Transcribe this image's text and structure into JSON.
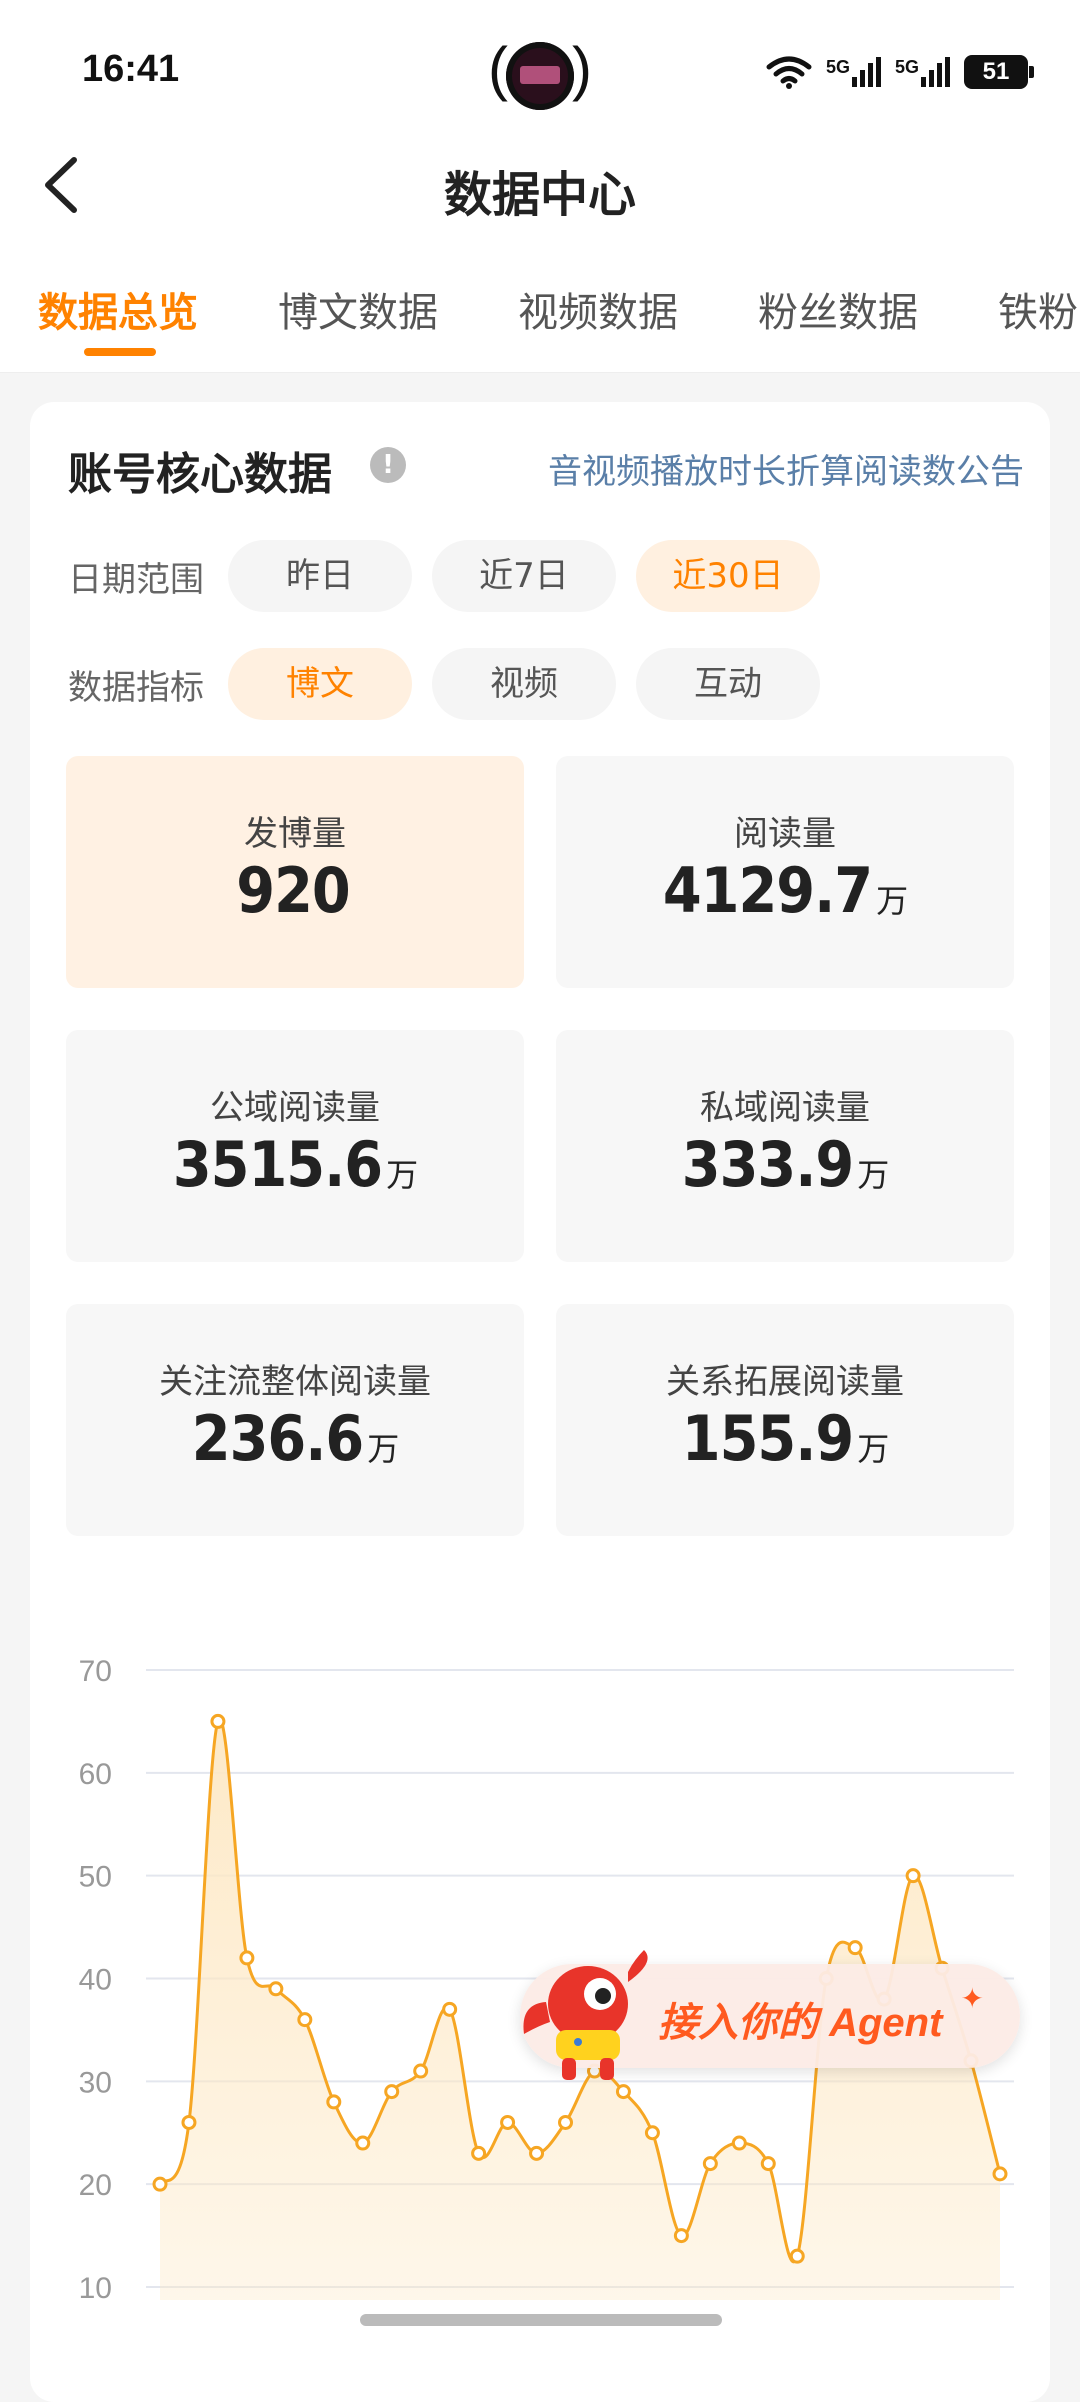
{
  "status_bar": {
    "time": "16:41",
    "battery": "51"
  },
  "header": {
    "title": "数据中心"
  },
  "tabs": [
    {
      "label": "数据总览",
      "active": true
    },
    {
      "label": "博文数据"
    },
    {
      "label": "视频数据"
    },
    {
      "label": "粉丝数据"
    },
    {
      "label": "铁粉"
    }
  ],
  "card": {
    "title": "账号核心数据",
    "notice_link": "音视频播放时长折算阅读数公告",
    "date_range": {
      "label": "日期范围",
      "options": [
        "昨日",
        "近7日",
        "近30日"
      ],
      "selected": "近30日"
    },
    "metric": {
      "label": "数据指标",
      "options": [
        "博文",
        "视频",
        "互动"
      ],
      "selected": "博文"
    },
    "stats": [
      {
        "label": "发博量",
        "value": "920",
        "unit": ""
      },
      {
        "label": "阅读量",
        "value": "4129.7",
        "unit": "万"
      },
      {
        "label": "公域阅读量",
        "value": "3515.6",
        "unit": "万"
      },
      {
        "label": "私域阅读量",
        "value": "333.9",
        "unit": "万"
      },
      {
        "label": "关注流整体阅读量",
        "value": "236.6",
        "unit": "万"
      },
      {
        "label": "关系拓展阅读量",
        "value": "155.9",
        "unit": "万"
      }
    ]
  },
  "chart_data": {
    "type": "area",
    "ylim": [
      10,
      70
    ],
    "y_ticks": [
      "10",
      "20",
      "30",
      "40",
      "50",
      "60",
      "70"
    ],
    "x": [
      1,
      2,
      3,
      4,
      5,
      6,
      7,
      8,
      9,
      10,
      11,
      12,
      13,
      14,
      15,
      16,
      17,
      18,
      19,
      20,
      21,
      22,
      23,
      24,
      25,
      26,
      27,
      28,
      29,
      30
    ],
    "series": [
      {
        "values": [
          20,
          26,
          65,
          42,
          39,
          36,
          28,
          24,
          29,
          31,
          37,
          23,
          26,
          23,
          26,
          31,
          29,
          25,
          15,
          22,
          24,
          22,
          13,
          40,
          43,
          38,
          50,
          41,
          32,
          21
        ]
      }
    ],
    "colors": {
      "line": "#f6a623",
      "fill": "#fde8c4"
    }
  },
  "agent_banner": {
    "text": "接入你的 Agent"
  }
}
